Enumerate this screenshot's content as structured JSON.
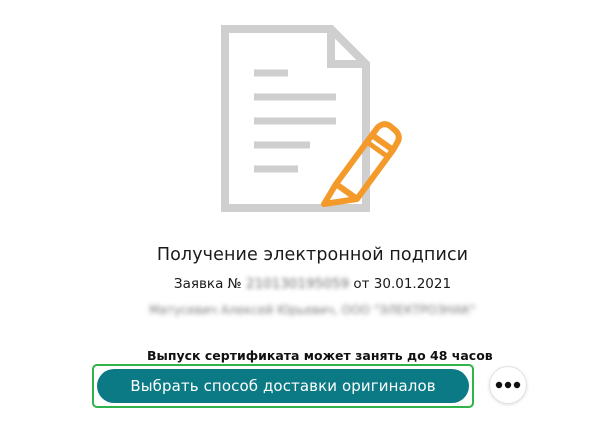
{
  "illustration": {
    "icon": "document-with-pencil-icon",
    "document_color": "#cfcfcf",
    "pencil_color": "#f39a2b"
  },
  "title": "Получение электронной подписи",
  "request": {
    "prefix": "Заявка №",
    "number": "210130195059",
    "date_prefix": "от",
    "date": "30.01.2021"
  },
  "applicant": "Матусевич Алексей Юрьевич, ООО \"ЭЛЕКТРОЗНАК\"",
  "notice": "Выпуск сертификата может занять до 48 часов",
  "primary_button": {
    "label": "Выбрать способ доставки оригиналов",
    "color": "#0b7a85",
    "highlight_color": "#2fb34a"
  },
  "more_button": {
    "icon": "more-dots-icon"
  }
}
